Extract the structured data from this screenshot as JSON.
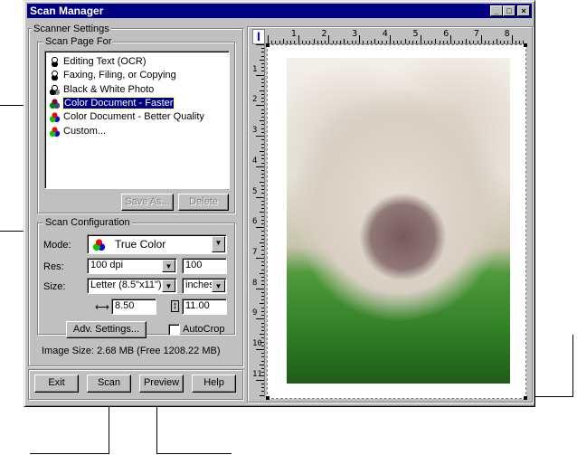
{
  "window": {
    "title": "Scan Manager",
    "controls": [
      "_",
      "□",
      "×"
    ]
  },
  "settings": {
    "group_label": "Scanner Settings",
    "scan_page_for": {
      "label": "Scan Page For",
      "items": [
        {
          "label": "Editing Text (OCR)",
          "icon": "bw-text-icon"
        },
        {
          "label": "Faxing, Filing, or Copying",
          "icon": "bw-text-icon"
        },
        {
          "label": "Black & White Photo",
          "icon": "grayscale-icon"
        },
        {
          "label": "Color Document - Faster",
          "icon": "color-dim-icon",
          "selected": true
        },
        {
          "label": "Color Document - Better Quality",
          "icon": "color-icon"
        },
        {
          "label": "Custom...",
          "icon": "color-icon"
        }
      ],
      "save_as": "Save As...",
      "delete": "Delete"
    },
    "config": {
      "label": "Scan Configuration",
      "mode_label": "Mode:",
      "mode_value": "True Color",
      "res_label": "Res:",
      "res_value": "100 dpi",
      "res_custom": "100",
      "size_label": "Size:",
      "size_value": "Letter (8.5\"x11\")",
      "units_value": "inches",
      "width_value": "8.50",
      "height_value": "11.00",
      "adv_settings": "Adv. Settings...",
      "autocrop": "AutoCrop",
      "autocrop_checked": false
    },
    "image_size": "Image Size: 2.68 MB (Free 1208.22 MB)"
  },
  "buttons": {
    "exit": "Exit",
    "scan": "Scan",
    "preview": "Preview",
    "help": "Help"
  },
  "ruler": {
    "top": [
      "1",
      "2",
      "3",
      "4",
      "5",
      "6",
      "7",
      "8"
    ],
    "left": [
      "1",
      "2",
      "3",
      "4",
      "5",
      "6",
      "7",
      "8",
      "9",
      "10",
      "11"
    ],
    "corner": "I"
  },
  "colors": {
    "titlebar": "#000080",
    "face": "#c0c0c0",
    "selection": "#000080"
  }
}
